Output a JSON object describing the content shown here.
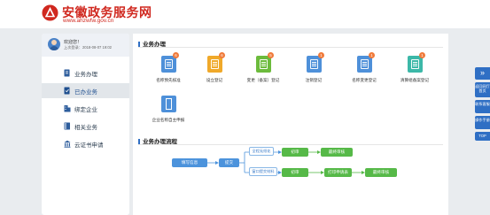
{
  "header": {
    "title": "安徽政务服务网",
    "url": "www.ahzwfw.gov.cn"
  },
  "profile": {
    "welcome": "欢迎您！",
    "last_login": "上次登录：2018-08-07 19:02"
  },
  "sidebar": {
    "items": [
      {
        "label": "业务办理",
        "icon": "document-icon"
      },
      {
        "label": "已办业务",
        "icon": "done-document-icon"
      },
      {
        "label": "绑定企业",
        "icon": "building-icon"
      },
      {
        "label": "相关业务",
        "icon": "book-icon"
      },
      {
        "label": "云证书申请",
        "icon": "certificate-icon"
      }
    ]
  },
  "main": {
    "business_title": "业务办理",
    "flow_title": "业务办理流程",
    "services": [
      {
        "label": "名称预先核准",
        "color": "#4e90d9",
        "badge": "6"
      },
      {
        "label": "设立登记",
        "color": "#f0a92a",
        "badge": "6"
      },
      {
        "label": "变更（备案）登记",
        "color": "#6cbb3c",
        "badge": "5"
      },
      {
        "label": "注销登记",
        "color": "#4e90d9",
        "badge": "1"
      },
      {
        "label": "名称变更登记",
        "color": "#4e90d9",
        "badge": "1"
      },
      {
        "label": "清算组备案登记",
        "color": "#3cb8a8",
        "badge": "1"
      },
      {
        "label": "企业名称自主申报",
        "color": "#4e90d9",
        "badge": ""
      }
    ],
    "flow": {
      "fill": "填写信息",
      "submit": "提交",
      "branch_top": "全程无纸化",
      "branch_bottom": "窗口提交材料",
      "review_top": "初审",
      "final_top": "最终审核",
      "review_bottom": "初审",
      "print_bottom": "打印申请表",
      "final_bottom": "最终审核"
    }
  },
  "side_tools": {
    "expand": "»",
    "items": [
      "返回网厅首页",
      "联系客服",
      "操作手册",
      "TOP"
    ]
  },
  "colors": {
    "brand_red": "#d0281f",
    "primary_blue": "#2f6fc4",
    "flow_blue": "#4c93dc",
    "flow_green": "#56b948",
    "badge_orange": "#f07a3a"
  }
}
